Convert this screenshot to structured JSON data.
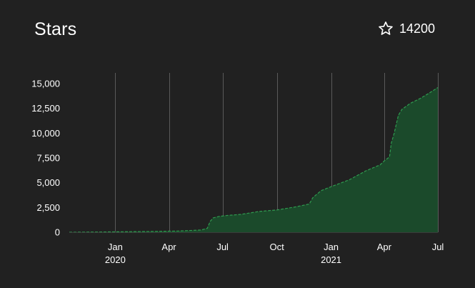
{
  "header": {
    "title": "Stars",
    "star_icon": "star-outline-icon",
    "count": "14200"
  },
  "colors": {
    "background": "#212121",
    "area_fill": "#1b4a2b",
    "line": "#2f9a4f",
    "grid": "#5a5a5a",
    "text": "#ffffff"
  },
  "chart_data": {
    "type": "area",
    "title": "Stars",
    "xlabel": "",
    "ylabel": "",
    "x_range": [
      "2019-10-15",
      "2021-07-01"
    ],
    "ylim": [
      0,
      15000
    ],
    "y_ticks": [
      0,
      2500,
      5000,
      7500,
      10000,
      12500,
      15000
    ],
    "y_tick_labels": [
      "0",
      "2,500",
      "5,000",
      "7,500",
      "10,000",
      "12,500",
      "15,000"
    ],
    "x_ticks": [
      {
        "date": "2020-01-01",
        "label": "Jan",
        "year": "2020"
      },
      {
        "date": "2020-04-01",
        "label": "Apr",
        "year": ""
      },
      {
        "date": "2020-07-01",
        "label": "Jul",
        "year": ""
      },
      {
        "date": "2020-10-01",
        "label": "Oct",
        "year": ""
      },
      {
        "date": "2021-01-01",
        "label": "Jan",
        "year": "2021"
      },
      {
        "date": "2021-04-01",
        "label": "Apr",
        "year": ""
      },
      {
        "date": "2021-07-01",
        "label": "Jul",
        "year": ""
      }
    ],
    "grid": "vertical",
    "series": [
      {
        "points": [
          [
            "2019-10-15",
            0
          ],
          [
            "2019-12-01",
            20
          ],
          [
            "2020-01-15",
            50
          ],
          [
            "2020-03-01",
            80
          ],
          [
            "2020-04-15",
            120
          ],
          [
            "2020-05-25",
            220
          ],
          [
            "2020-06-05",
            400
          ],
          [
            "2020-06-10",
            1100
          ],
          [
            "2020-06-15",
            1450
          ],
          [
            "2020-06-25",
            1600
          ],
          [
            "2020-07-10",
            1700
          ],
          [
            "2020-08-01",
            1800
          ],
          [
            "2020-09-01",
            2100
          ],
          [
            "2020-10-01",
            2250
          ],
          [
            "2020-11-01",
            2550
          ],
          [
            "2020-11-25",
            2850
          ],
          [
            "2020-12-01",
            3500
          ],
          [
            "2020-12-15",
            4200
          ],
          [
            "2021-01-01",
            4600
          ],
          [
            "2021-02-01",
            5300
          ],
          [
            "2021-03-01",
            6200
          ],
          [
            "2021-03-25",
            6800
          ],
          [
            "2021-04-01",
            7200
          ],
          [
            "2021-04-10",
            7600
          ],
          [
            "2021-04-13",
            9000
          ],
          [
            "2021-04-18",
            10000
          ],
          [
            "2021-04-25",
            11800
          ],
          [
            "2021-05-01",
            12400
          ],
          [
            "2021-05-15",
            13000
          ],
          [
            "2021-06-01",
            13500
          ],
          [
            "2021-06-15",
            14000
          ],
          [
            "2021-07-01",
            14600
          ]
        ]
      }
    ]
  }
}
